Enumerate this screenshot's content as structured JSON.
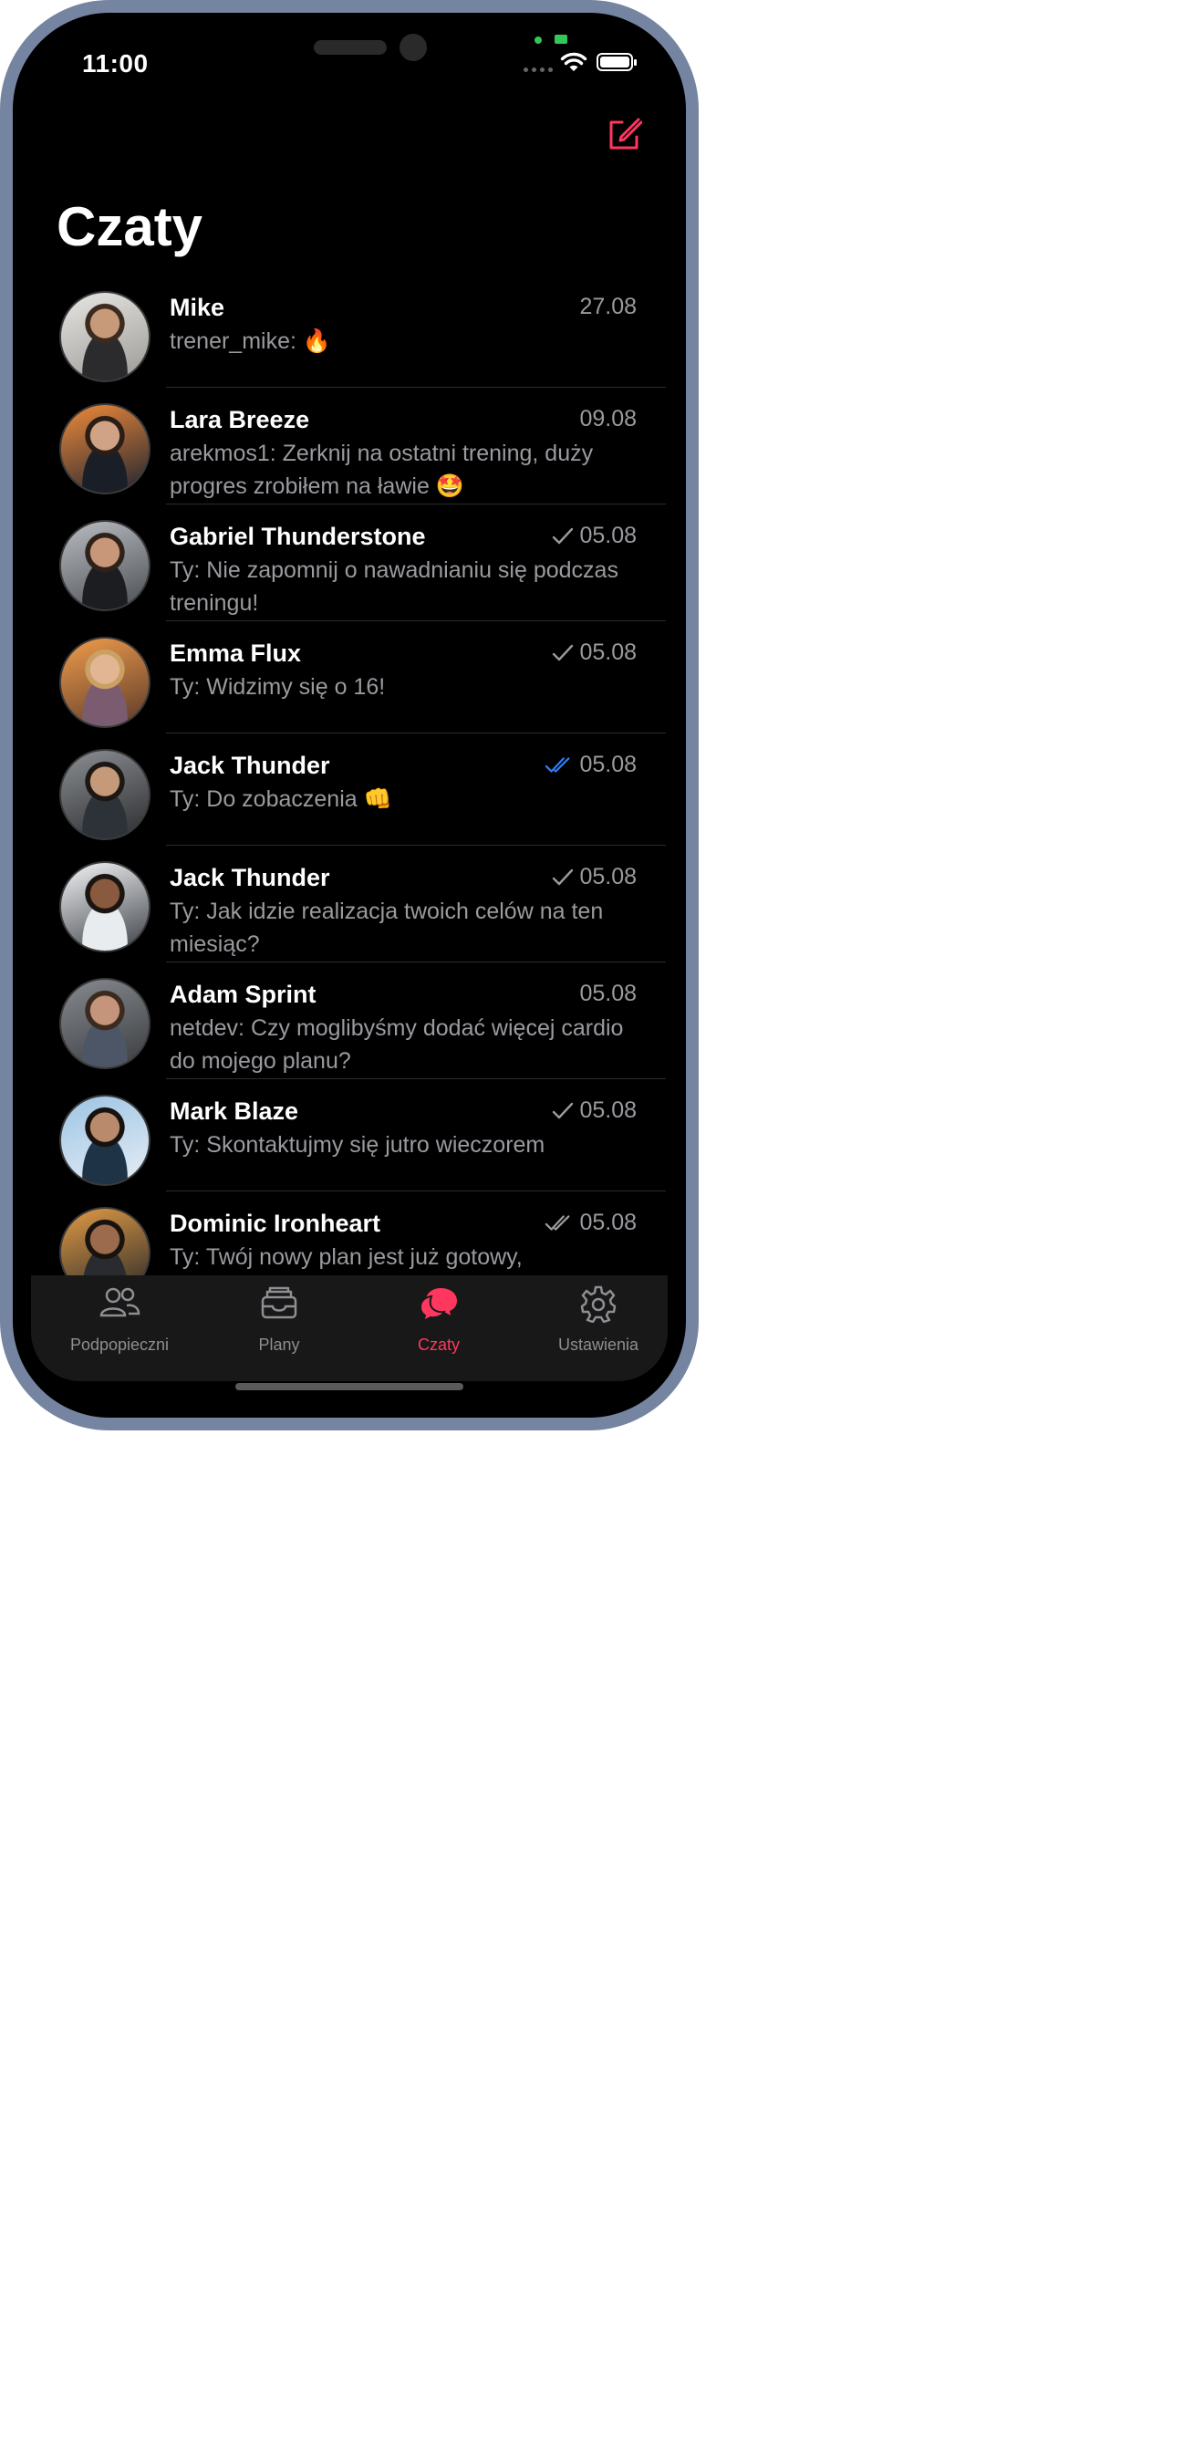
{
  "status_bar": {
    "time": "11:00"
  },
  "header": {
    "title": "Czaty",
    "compose_icon": "compose-icon"
  },
  "colors": {
    "accent": "#ff375f",
    "read_check": "#2f7cf6",
    "muted": "#9a9a9f"
  },
  "chats": [
    {
      "name": "Mike",
      "date": "27.08",
      "message": "trener_mike: 🔥",
      "status": "none"
    },
    {
      "name": "Lara Breeze",
      "date": "09.08",
      "message": "arekmos1: Zerknij na ostatni trening, duży progres zrobiłem na ławie 🤩",
      "status": "none"
    },
    {
      "name": "Gabriel Thunderstone",
      "date": "05.08",
      "message": "Ty: Nie zapomnij o nawadnianiu się podczas treningu!",
      "status": "sent"
    },
    {
      "name": "Emma Flux",
      "date": "05.08",
      "message": "Ty: Widzimy się o 16!",
      "status": "sent"
    },
    {
      "name": "Jack Thunder",
      "date": "05.08",
      "message": "Ty: Do zobaczenia 👊",
      "status": "read"
    },
    {
      "name": "Jack Thunder",
      "date": "05.08",
      "message": "Ty: Jak idzie realizacja twoich celów na ten miesiąc?",
      "status": "sent"
    },
    {
      "name": "Adam Sprint",
      "date": "05.08",
      "message": "netdev: Czy moglibyśmy dodać więcej cardio do mojego planu?",
      "status": "none"
    },
    {
      "name": "Mark Blaze",
      "date": "05.08",
      "message": "Ty: Skontaktujmy się jutro wieczorem",
      "status": "sent"
    },
    {
      "name": "Dominic Ironheart",
      "date": "05.08",
      "message": "Ty: Twój nowy plan jest już gotowy, pozdrawiam!",
      "status": "delivered"
    }
  ],
  "tab_bar": [
    {
      "label": "Podpopieczni",
      "icon": "people-icon"
    },
    {
      "label": "Plany",
      "icon": "tray-icon"
    },
    {
      "label": "Czaty",
      "icon": "chat-bubbles-icon",
      "active": true
    },
    {
      "label": "Ustawienia",
      "icon": "gear-icon"
    }
  ]
}
